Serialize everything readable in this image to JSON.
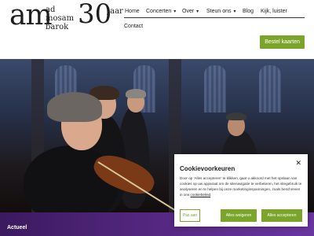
{
  "brand": {
    "logo_mark": "am",
    "logo_words": [
      "ad",
      "mosam",
      "barok"
    ],
    "anniversary_number": "30",
    "anniversary_word": "jaar"
  },
  "nav": {
    "items": [
      {
        "label": "Home",
        "active": true
      },
      {
        "label": "Concerten",
        "dropdown": true
      },
      {
        "label": "Over",
        "dropdown": true
      },
      {
        "label": "Steun ons",
        "dropdown": true
      },
      {
        "label": "Blog"
      },
      {
        "label": "Kijk, luister"
      }
    ],
    "contact": "Contact",
    "caret_icon": "chevron-down-icon",
    "cta": "Bestel kaarten"
  },
  "hero": {
    "slides_total": 3,
    "active_slide": 1
  },
  "band": {
    "label": "Actueel"
  },
  "cookie": {
    "title": "Cookievoorkeuren",
    "close_icon": "close-icon",
    "body_text": "Door op 'Alles accepteren' te klikken, gaat u akkoord met het opslaan van cookies op uw apparaat om de sitenavigatie te verbeteren, het sitegebruik te analyseren en te helpen bij onze marketinginspanningen, zoals beschreven in ons",
    "link_text": "cookiebeleid",
    "customize_label": "Pas aan",
    "reject_label": "Alles weigeren",
    "accept_label": "Alles accepteren"
  },
  "colors": {
    "accent_green": "#7ba52a",
    "band_purple": "#5a2a87"
  }
}
